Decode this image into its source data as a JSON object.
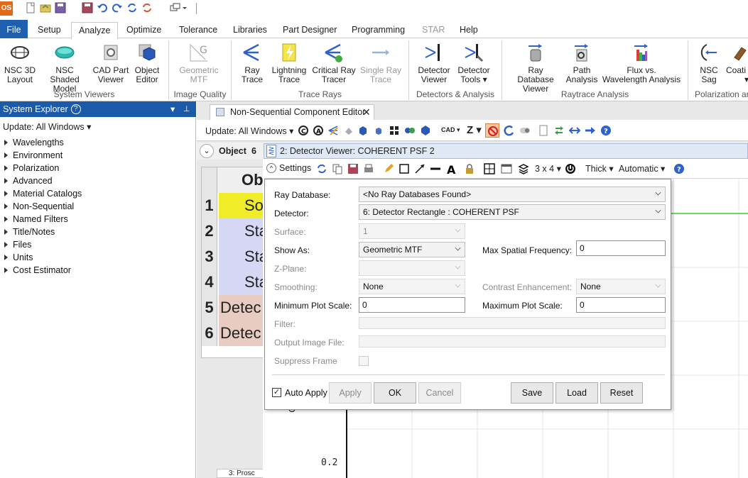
{
  "app": {
    "logo": "OS"
  },
  "tabs": [
    "File",
    "Setup",
    "Analyze",
    "Optimize",
    "Tolerance",
    "Libraries",
    "Part Designer",
    "Programming",
    "STAR",
    "Help"
  ],
  "ribbon": {
    "buttons": [
      {
        "l1": "NSC 3D",
        "l2": "Layout"
      },
      {
        "l1": "NSC Shaded",
        "l2": "Model"
      },
      {
        "l1": "CAD Part",
        "l2": "Viewer"
      },
      {
        "l1": "Object",
        "l2": "Editor"
      },
      {
        "l1": "Geometric",
        "l2": "MTF"
      },
      {
        "l1": "Ray",
        "l2": "Trace"
      },
      {
        "l1": "Lightning",
        "l2": "Trace"
      },
      {
        "l1": "Critical Ray",
        "l2": "Tracer"
      },
      {
        "l1": "Single Ray",
        "l2": "Trace"
      },
      {
        "l1": "Detector",
        "l2": "Viewer"
      },
      {
        "l1": "Detector",
        "l2": "Tools ▾"
      },
      {
        "l1": "Ray Database",
        "l2": "Viewer"
      },
      {
        "l1": "Path",
        "l2": "Analysis"
      },
      {
        "l1": "Flux vs.",
        "l2": "Wavelength Analysis"
      },
      {
        "l1": "NSC",
        "l2": "Sag"
      },
      {
        "l1": "Coati",
        "l2": "▾"
      }
    ],
    "groups": [
      "System Viewers",
      "Image Quality",
      "Trace Rays",
      "Detectors & Analysis",
      "Raytrace Analysis",
      "Polarization ar"
    ]
  },
  "system_explorer": {
    "title": "System Explorer",
    "update": "Update: All Windows ▾",
    "items": [
      "Wavelengths",
      "Environment",
      "Polarization",
      "Advanced",
      "Material Catalogs",
      "Non-Sequential",
      "Named Filters",
      "Title/Notes",
      "Files",
      "Units",
      "Cost Estimator"
    ]
  },
  "nsc": {
    "tab": "Non-Sequential Component Editor",
    "update": "Update: All Windows ▾",
    "cad_label": "CAD ▾",
    "z_label": "Z ▾",
    "object_label": "Object",
    "object_num": "6",
    "grid_header": "Ob",
    "rows": [
      {
        "n": "1",
        "t": "So",
        "c": "#f0ec27"
      },
      {
        "n": "2",
        "t": "Sta",
        "c": "#d5d7f4"
      },
      {
        "n": "3",
        "t": "Sta",
        "c": "#d5d7f4"
      },
      {
        "n": "4",
        "t": "Sta",
        "c": "#d5d7f4"
      },
      {
        "n": "5",
        "t": "Detec",
        "c": "#e8cbc1"
      },
      {
        "n": "6",
        "t": "Detec",
        "c": "#e8cbc1"
      }
    ],
    "bottom_tab": "3: Prosc"
  },
  "detector_viewer": {
    "title": "2: Detector Viewer: COHERENT PSF 2",
    "settings": "Settings",
    "layout": "3 x 4 ▾",
    "thick": "Thick ▾",
    "automatic": "Automatic ▾",
    "plot_tick": "0.2",
    "plot_axis_glyph": "G"
  },
  "settings": {
    "ray_database_label": "Ray Database:",
    "ray_database_value": "<No Ray Databases Found>",
    "detector_label": "Detector:",
    "detector_value": "6: Detector Rectangle : COHERENT PSF",
    "surface_label": "Surface:",
    "surface_value": "1",
    "show_as_label": "Show As:",
    "show_as_value": "Geometric MTF",
    "max_freq_label": "Max Spatial Frequency:",
    "max_freq_value": "0",
    "zplane_label": "Z-Plane:",
    "smoothing_label": "Smoothing:",
    "smoothing_value": "None",
    "contrast_label": "Contrast Enhancement:",
    "contrast_value": "None",
    "min_plot_label": "Minimum Plot Scale:",
    "min_plot_value": "0",
    "max_plot_label": "Maximum Plot Scale:",
    "max_plot_value": "0",
    "filter_label": "Filter:",
    "output_label": "Output Image File:",
    "suppress_label": "Suppress Frame",
    "auto_apply": "Auto Apply",
    "apply": "Apply",
    "ok": "OK",
    "cancel": "Cancel",
    "save": "Save",
    "load": "Load",
    "reset": "Reset"
  },
  "colors": {
    "accent": "#1b5aa8",
    "file_tab": "#1f5fb0",
    "plot_line": "#39d12a"
  }
}
